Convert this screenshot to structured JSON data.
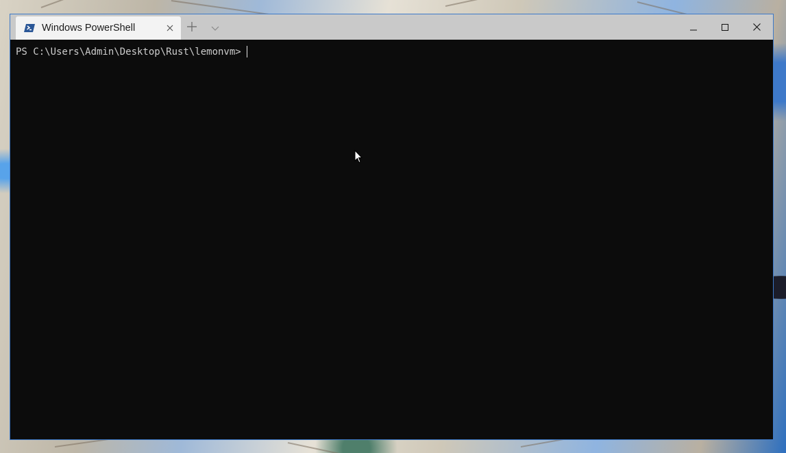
{
  "window": {
    "tab_title": "Windows PowerShell",
    "tab_icon": "powershell-icon",
    "border_color": "#3c79c9",
    "titlebar_color": "#c9c9c9",
    "terminal_background": "#0c0c0c"
  },
  "terminal": {
    "prompt": "PS C:\\Users\\Admin\\Desktop\\Rust\\lemonvm>",
    "text_color": "#cccccc"
  },
  "icons": {
    "new_tab": "plus-icon",
    "dropdown": "chevron-down-icon",
    "minimize": "minimize-icon",
    "maximize": "maximize-icon",
    "close": "close-icon",
    "tab_close": "close-icon",
    "pointer": "mouse-pointer-icon"
  }
}
